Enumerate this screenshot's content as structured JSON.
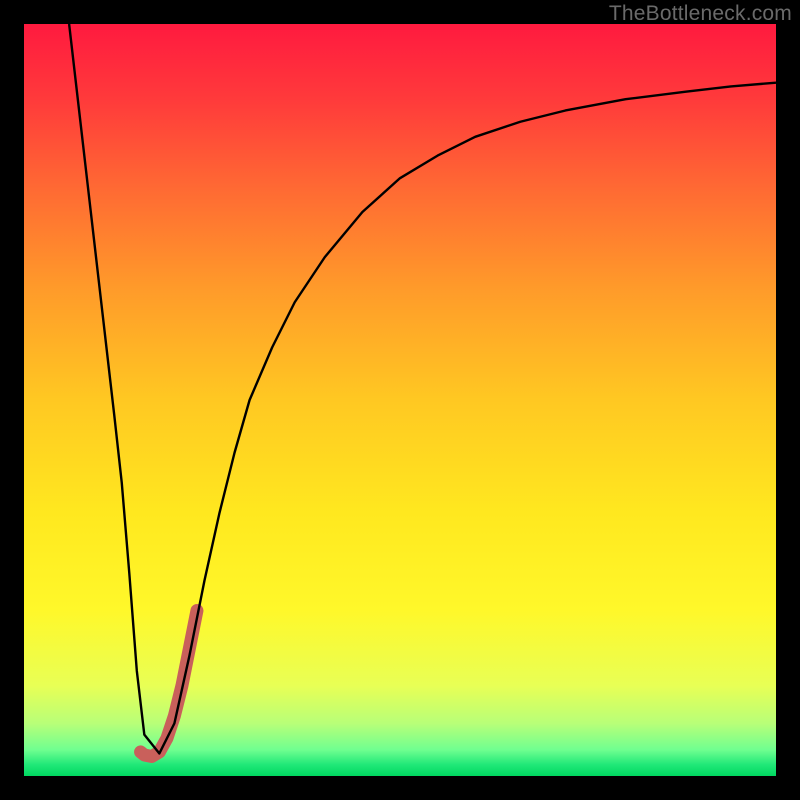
{
  "watermark": {
    "text": "TheBottleneck.com"
  },
  "gradient": {
    "stops": [
      {
        "offset": 0.0,
        "color": "#ff1a3f"
      },
      {
        "offset": 0.1,
        "color": "#ff3a3b"
      },
      {
        "offset": 0.22,
        "color": "#ff6a33"
      },
      {
        "offset": 0.35,
        "color": "#ff9a2a"
      },
      {
        "offset": 0.5,
        "color": "#ffc822"
      },
      {
        "offset": 0.65,
        "color": "#ffe81f"
      },
      {
        "offset": 0.78,
        "color": "#fff82a"
      },
      {
        "offset": 0.88,
        "color": "#e8ff55"
      },
      {
        "offset": 0.93,
        "color": "#b8ff78"
      },
      {
        "offset": 0.965,
        "color": "#70ff90"
      },
      {
        "offset": 0.985,
        "color": "#20e878"
      },
      {
        "offset": 1.0,
        "color": "#00d860"
      }
    ]
  },
  "chart_data": {
    "type": "line",
    "title": "",
    "xlabel": "",
    "ylabel": "",
    "xlim": [
      0,
      100
    ],
    "ylim": [
      0,
      100
    ],
    "series": [
      {
        "name": "bottleneck-curve",
        "stroke": "#000000",
        "stroke_width": 2.4,
        "x": [
          6.0,
          7.5,
          9.0,
          10.5,
          12.0,
          13.0,
          14.0,
          15.0,
          16.0,
          18.0,
          20.0,
          22.0,
          24.0,
          26.0,
          28.0,
          30.0,
          33.0,
          36.0,
          40.0,
          45.0,
          50.0,
          55.0,
          60.0,
          66.0,
          72.0,
          80.0,
          88.0,
          94.0,
          100.0
        ],
        "y": [
          100.0,
          87.0,
          74.0,
          61.0,
          48.0,
          39.0,
          27.0,
          14.0,
          5.5,
          3.0,
          7.0,
          16.0,
          26.0,
          35.0,
          43.0,
          50.0,
          57.0,
          63.0,
          69.0,
          75.0,
          79.5,
          82.5,
          85.0,
          87.0,
          88.5,
          90.0,
          91.0,
          91.7,
          92.2
        ]
      },
      {
        "name": "highlight-hook",
        "stroke": "#c9605b",
        "stroke_width": 13,
        "linecap": "round",
        "x": [
          15.5,
          16.0,
          17.0,
          18.0,
          19.0,
          20.0,
          21.0,
          22.0,
          23.0
        ],
        "y": [
          3.2,
          2.8,
          2.6,
          3.2,
          5.0,
          8.0,
          12.0,
          17.0,
          22.0
        ]
      }
    ]
  }
}
